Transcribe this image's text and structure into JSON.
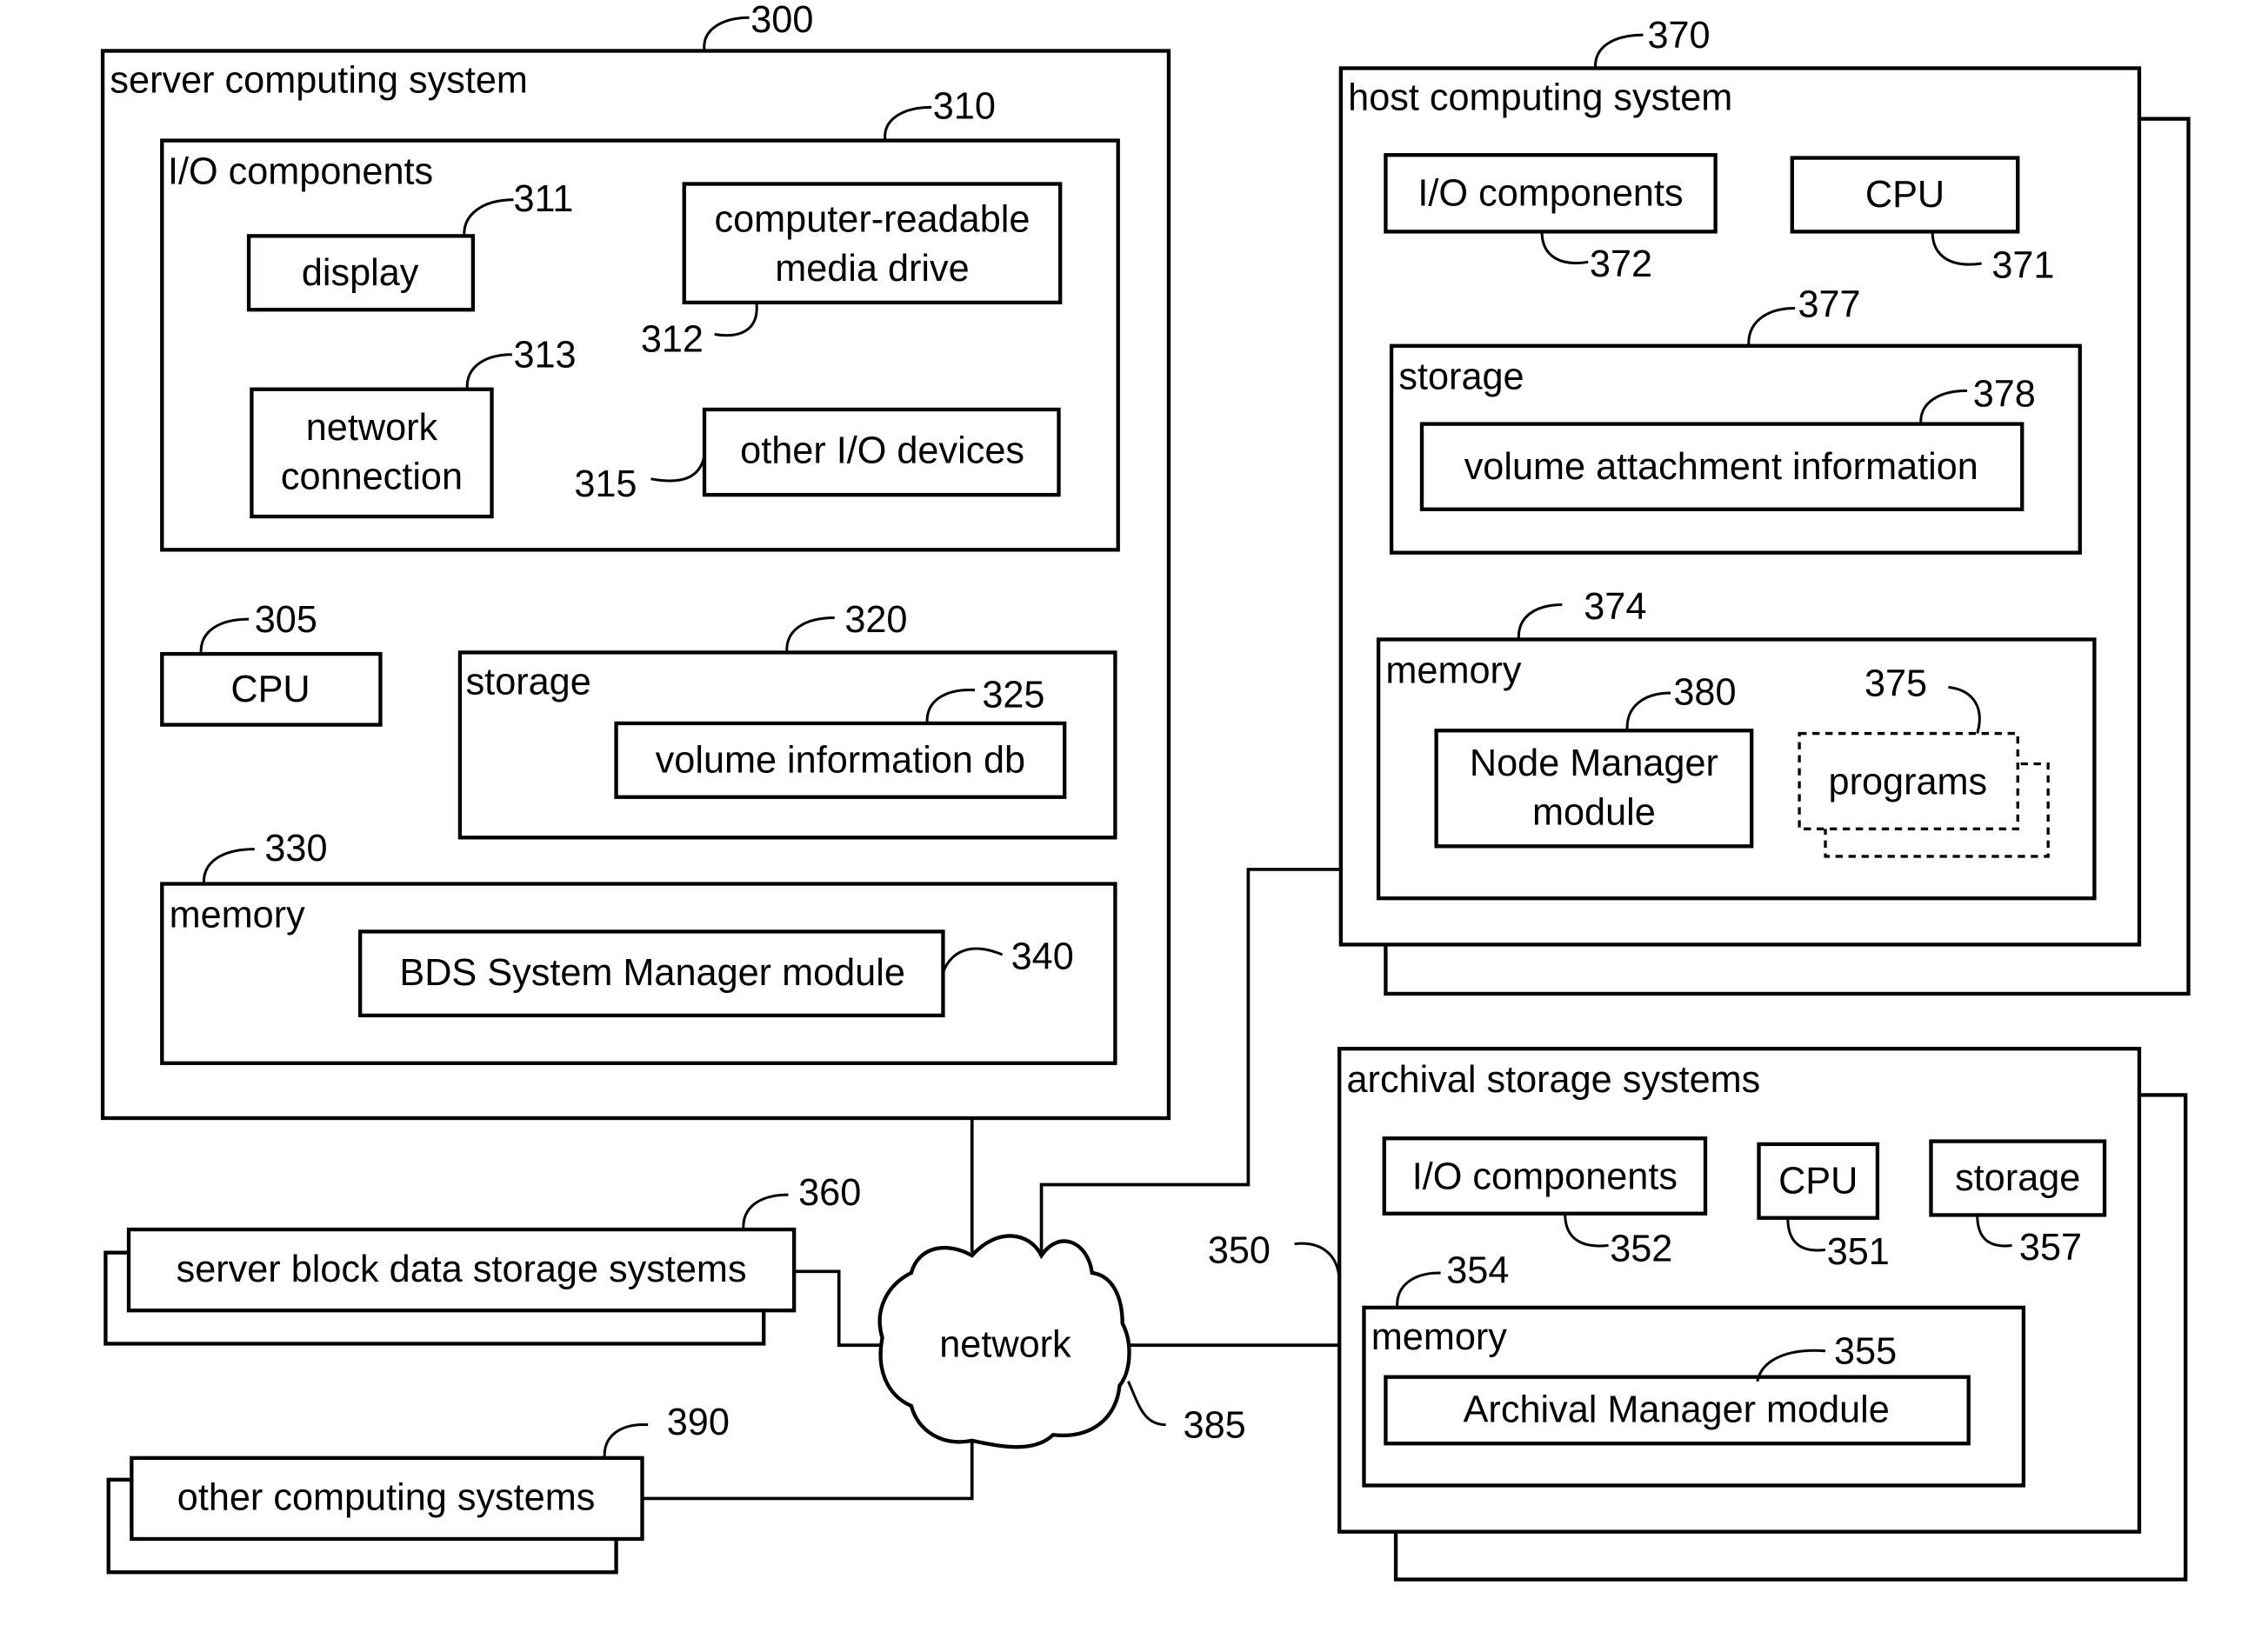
{
  "diagram": {
    "server": {
      "title": "server computing system",
      "ref": "300",
      "io": {
        "title": "I/O components",
        "ref": "310",
        "display": {
          "label": "display",
          "ref": "311"
        },
        "media_drive": {
          "line1": "computer-readable",
          "line2": "media drive",
          "ref": "312"
        },
        "network_connection": {
          "line1": "network",
          "line2": "connection",
          "ref": "313"
        },
        "other_io": {
          "label": "other I/O devices",
          "ref": "315"
        }
      },
      "cpu": {
        "label": "CPU",
        "ref": "305"
      },
      "storage": {
        "title": "storage",
        "ref": "320",
        "volume_db": {
          "label": "volume information db",
          "ref": "325"
        }
      },
      "memory": {
        "title": "memory",
        "ref": "330",
        "bds": {
          "label": "BDS System Manager module",
          "ref": "340"
        }
      }
    },
    "host": {
      "title": "host computing system",
      "ref": "370",
      "io": {
        "label": "I/O components",
        "ref": "372"
      },
      "cpu": {
        "label": "CPU",
        "ref": "371"
      },
      "storage": {
        "title": "storage",
        "ref": "377",
        "vol_attach": {
          "label": "volume attachment information",
          "ref": "378"
        }
      },
      "memory": {
        "title": "memory",
        "ref": "374",
        "node_manager": {
          "line1": "Node Manager",
          "line2": "module",
          "ref": "380"
        },
        "programs": {
          "label": "programs",
          "ref": "375"
        }
      }
    },
    "archival": {
      "title": "archival storage systems",
      "ref": "350",
      "io": {
        "label": "I/O components",
        "ref": "352"
      },
      "cpu": {
        "label": "CPU",
        "ref": "351"
      },
      "storage": {
        "label": "storage",
        "ref": "357"
      },
      "memory": {
        "title": "memory",
        "ref": "354",
        "archival_manager": {
          "label": "Archival Manager module",
          "ref": "355"
        }
      }
    },
    "block_storage": {
      "label": "server block data storage systems",
      "ref": "360"
    },
    "other_systems": {
      "label": "other computing systems",
      "ref": "390"
    },
    "network": {
      "label": "network",
      "ref": "385"
    }
  }
}
